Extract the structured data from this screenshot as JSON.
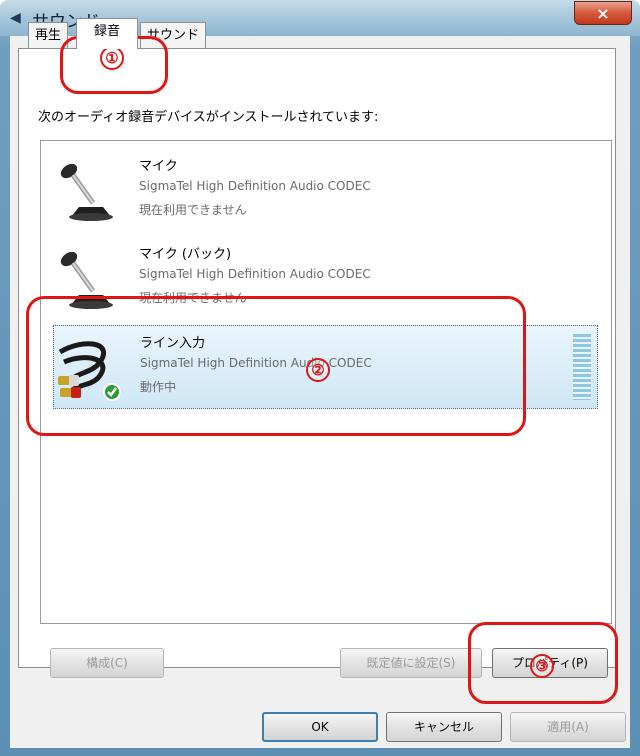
{
  "window": {
    "title": "サウンド",
    "close_label": "×"
  },
  "tabs": [
    {
      "label": "再生"
    },
    {
      "label": "録音"
    },
    {
      "label": "サウンド"
    }
  ],
  "instruction": "次のオーディオ録音デバイスがインストールされています:",
  "devices": [
    {
      "name": "マイク",
      "driver": "SigmaTel High Definition Audio CODEC",
      "status": "現在利用できません",
      "icon": "microphone-icon"
    },
    {
      "name": "マイク (バック)",
      "driver": "SigmaTel High Definition Audio CODEC",
      "status": "現在利用できません",
      "icon": "microphone-icon"
    },
    {
      "name": "ライン入力",
      "driver": "SigmaTel High Definition Audio CODEC",
      "status": "動作中",
      "icon": "rca-cable-icon",
      "selected": true
    }
  ],
  "buttons": {
    "configure": "構成(C)",
    "set_default": "既定値に設定(S)",
    "properties": "プロパティ(P)",
    "ok": "OK",
    "cancel": "キャンセル",
    "apply": "適用(A)"
  },
  "callouts": [
    "①",
    "②",
    "③"
  ],
  "colors": {
    "callout": "#e01515",
    "selection": "#cfe7f6",
    "default_button_border": "#3c7fb1"
  }
}
